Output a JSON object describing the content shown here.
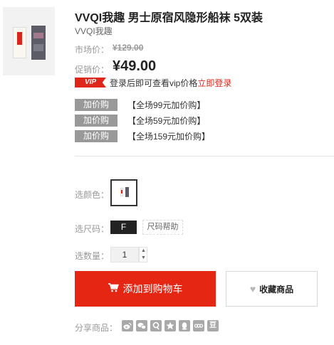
{
  "product": {
    "title": "VVQI我趣 男士原宿风隐形船袜 5双装",
    "brand": "VVQI我趣"
  },
  "pricing": {
    "market_label": "市场价：",
    "market_price": "¥129.00",
    "sale_label": "促销价：",
    "sale_price": "¥49.00"
  },
  "vip": {
    "badge": "VIP",
    "text": "登录后即可查看vip价格",
    "link": "立即登录"
  },
  "promotions": [
    {
      "tag": "加价购",
      "desc": "【全场99元加价购】"
    },
    {
      "tag": "加价购",
      "desc": "【全场59元加价购】"
    },
    {
      "tag": "加价购",
      "desc": "【全场159元加价购】"
    }
  ],
  "options": {
    "color_label": "选颜色：",
    "size_label": "选尺码：",
    "size_value": "F",
    "size_help": "尺码帮助",
    "qty_label": "选数量：",
    "qty_value": "1"
  },
  "actions": {
    "add_to_cart": "添加到购物车",
    "favorite": "收藏商品"
  },
  "share": {
    "label": "分享商品：",
    "icons": [
      "weibo-icon",
      "wechat-icon",
      "qzone-icon",
      "star-icon",
      "qq-icon",
      "renren-icon",
      "douban-icon"
    ],
    "douban_glyph": "豆"
  },
  "colors": {
    "accent_red": "#e42613",
    "promo_tag_gray": "#999999"
  }
}
